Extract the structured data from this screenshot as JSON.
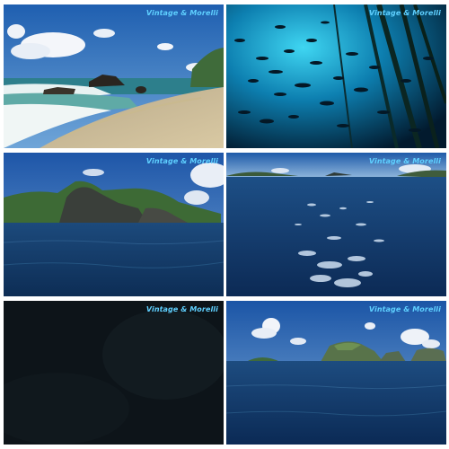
{
  "watermark": "Vintage & Morelli",
  "frames": [
    {
      "scene": "beach-with-waves-and-rocks"
    },
    {
      "scene": "underwater-fish-school"
    },
    {
      "scene": "rocky-island-over-sea"
    },
    {
      "scene": "open-ocean-surface"
    },
    {
      "scene": "dark-night-frame"
    },
    {
      "scene": "distant-islands-under-clouds"
    }
  ]
}
